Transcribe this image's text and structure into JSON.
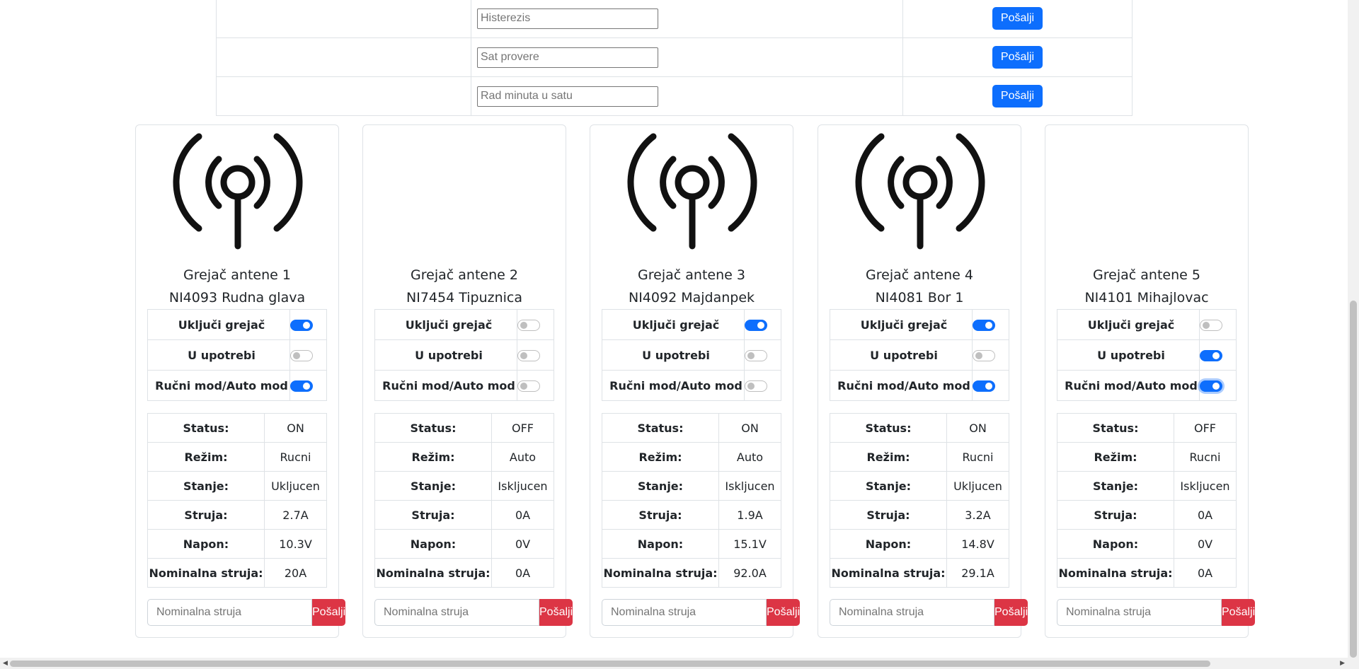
{
  "settings_rows": [
    {
      "placeholder": "Histerezis",
      "button": "Pošalji"
    },
    {
      "placeholder": "Sat provere",
      "button": "Pošalji"
    },
    {
      "placeholder": "Rad minuta u satu",
      "button": "Pošalji"
    }
  ],
  "labels": {
    "switch_heater": "Uključi grejač",
    "in_use": "U upotrebi",
    "mode": "Ručni mod/Auto mod",
    "status": "Status:",
    "regime": "Režim:",
    "state": "Stanje:",
    "current": "Struja:",
    "voltage": "Napon:",
    "nominal": "Nominalna struja:",
    "nominal_placeholder": "Nominalna struja",
    "send": "Pošalji"
  },
  "cards": [
    {
      "title": "Grejač antene 1",
      "site": "NI4093 Rudna glava",
      "icon": "antenna-icon",
      "switches": [
        true,
        false,
        true
      ],
      "status": "ON",
      "regime": "Rucni",
      "state": "Ukljucen",
      "current": "2.7A",
      "voltage": "10.3V",
      "nominal": "20A"
    },
    {
      "title": "Grejač antene 2",
      "site": "NI7454 Tipuznica",
      "icon": "",
      "switches": [
        false,
        false,
        false
      ],
      "status": "OFF",
      "regime": "Auto",
      "state": "Iskljucen",
      "current": "0A",
      "voltage": "0V",
      "nominal": "0A"
    },
    {
      "title": "Grejač antene 3",
      "site": "NI4092 Majdanpek",
      "icon": "antenna-icon",
      "switches": [
        true,
        false,
        false
      ],
      "status": "ON",
      "regime": "Auto",
      "state": "Iskljucen",
      "current": "1.9A",
      "voltage": "15.1V",
      "nominal": "92.0A"
    },
    {
      "title": "Grejač antene 4",
      "site": "NI4081 Bor 1",
      "icon": "antenna-icon",
      "switches": [
        true,
        false,
        true
      ],
      "status": "ON",
      "regime": "Rucni",
      "state": "Ukljucen",
      "current": "3.2A",
      "voltage": "14.8V",
      "nominal": "29.1A"
    },
    {
      "title": "Grejač antene 5",
      "site": "NI4101 Mihajlovac",
      "icon": "",
      "switches": [
        false,
        true,
        true
      ],
      "status": "OFF",
      "regime": "Rucni",
      "state": "Iskljucen",
      "current": "0A",
      "voltage": "0V",
      "nominal": "0A"
    }
  ],
  "colors": {
    "primary": "#0d6efd",
    "danger": "#dc3545",
    "border": "#dee2e6"
  }
}
